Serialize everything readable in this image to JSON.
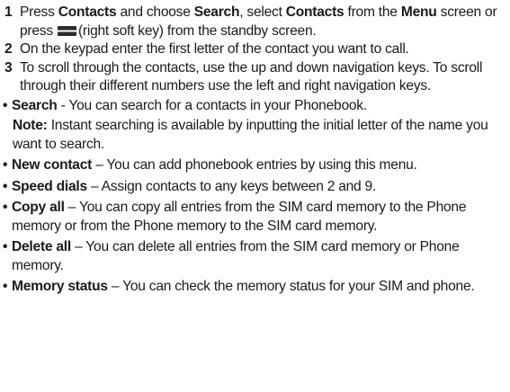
{
  "steps": [
    {
      "num": "1",
      "t1": "Press ",
      "b1": "Contacts",
      "t2": " and choose ",
      "b2": "Search",
      "t3": ", select ",
      "b3": "Contacts",
      "t4": " from the ",
      "b4": "Menu",
      "t5": " screen or press ",
      "icon": "right-soft-key-icon",
      "t6": "(right soft key) from the standby screen."
    },
    {
      "num": "2",
      "text": "On the keypad enter the first letter of the contact you want to call."
    },
    {
      "num": "3",
      "text": "To scroll through the contacts, use the up and down navigation keys. To scroll through their different numbers use the left and right navigation keys."
    }
  ],
  "items": [
    {
      "title": "Search",
      "sep": " - ",
      "text": "You can search for a contacts in your Phonebook.",
      "note_label": "Note:",
      "note_text": " Instant searching is available by inputting the initial letter of the name you want to search."
    },
    {
      "title": "New contact",
      "sep": " – ",
      "text": "You can add phonebook entries by using this menu."
    },
    {
      "title": "Speed dials",
      "sep": " – ",
      "text": "Assign contacts to any keys between 2 and 9."
    },
    {
      "title": "Copy all",
      "sep": " – ",
      "text": "You can copy all entries from the SIM card memory to the Phone memory or from the Phone memory to the SIM card memory."
    },
    {
      "title": "Delete all",
      "sep": " – ",
      "text": "You can delete all entries from the SIM card memory or Phone memory."
    },
    {
      "title": "Memory status",
      "sep": " – ",
      "text": "You can check the memory status for your SIM and phone."
    }
  ],
  "bullet": "•"
}
